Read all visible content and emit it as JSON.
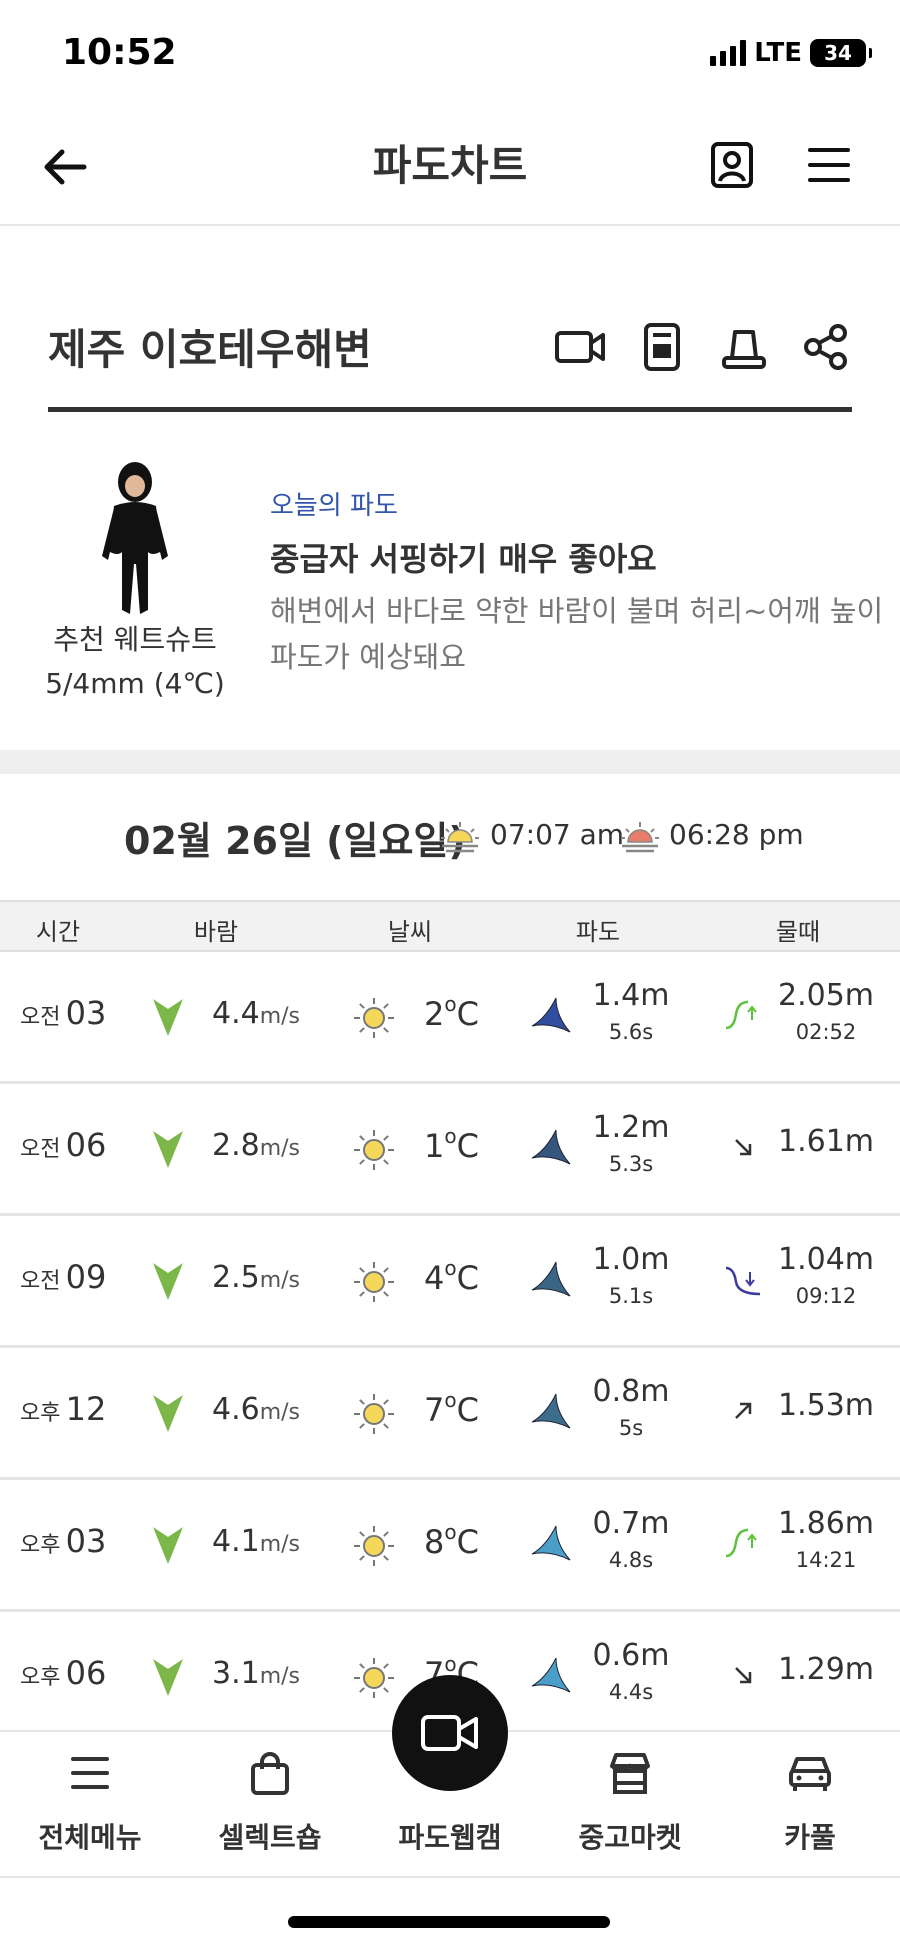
{
  "status": {
    "time": "10:52",
    "network": "LTE",
    "battery": "34"
  },
  "header": {
    "title": "파도차트",
    "back_icon": "back-arrow-icon",
    "profile_icon": "profile-icon",
    "menu_icon": "menu-icon"
  },
  "beach": {
    "name": "제주 이호테우해변",
    "icons": [
      "video-icon",
      "memo-icon",
      "alarm-icon",
      "share-icon"
    ]
  },
  "today": {
    "wetsuit_label": "추천 웨트슈트",
    "wetsuit_value": "5/4mm (4℃)",
    "label": "오늘의 파도",
    "headline": "중급자 서핑하기 매우 좋아요",
    "description": "해변에서 바다로 약한 바람이 불며 허리~어깨 높이 파도가 예상돼요"
  },
  "date": {
    "text": "02월 26일 (일요일)",
    "sunrise": "07:07 am",
    "sunset": "06:28 pm"
  },
  "columns": {
    "time": "시간",
    "wind": "바람",
    "weather": "날씨",
    "wave": "파도",
    "tide": "물때"
  },
  "rows": [
    {
      "ampm": "오전",
      "hour": "03",
      "wind": "4.4",
      "wind_unit": "m/s",
      "temp": "2",
      "wave_height": "1.4m",
      "wave_period": "5.6s",
      "wave_color": "#2f4f9e",
      "tide_icon": "high-tide",
      "tide_height": "2.05m",
      "tide_time": "02:52"
    },
    {
      "ampm": "오전",
      "hour": "06",
      "wind": "2.8",
      "wind_unit": "m/s",
      "temp": "1",
      "wave_height": "1.2m",
      "wave_period": "5.3s",
      "wave_color": "#35577f",
      "tide_icon": "falling",
      "tide_height": "1.61m",
      "tide_time": ""
    },
    {
      "ampm": "오전",
      "hour": "09",
      "wind": "2.5",
      "wind_unit": "m/s",
      "temp": "4",
      "wave_height": "1.0m",
      "wave_period": "5.1s",
      "wave_color": "#3a6685",
      "tide_icon": "low-tide",
      "tide_height": "1.04m",
      "tide_time": "09:12"
    },
    {
      "ampm": "오후",
      "hour": "12",
      "wind": "4.6",
      "wind_unit": "m/s",
      "temp": "7",
      "wave_height": "0.8m",
      "wave_period": "5s",
      "wave_color": "#3c6e8c",
      "tide_icon": "rising",
      "tide_height": "1.53m",
      "tide_time": ""
    },
    {
      "ampm": "오후",
      "hour": "03",
      "wind": "4.1",
      "wind_unit": "m/s",
      "temp": "8",
      "wave_height": "0.7m",
      "wave_period": "4.8s",
      "wave_color": "#4a9fca",
      "tide_icon": "high-tide",
      "tide_height": "1.86m",
      "tide_time": "14:21"
    },
    {
      "ampm": "오후",
      "hour": "06",
      "wind": "3.1",
      "wind_unit": "m/s",
      "temp": "7",
      "wave_height": "0.6m",
      "wave_period": "4.4s",
      "wave_color": "#4a9fca",
      "tide_icon": "falling",
      "tide_height": "1.29m",
      "tide_time": ""
    }
  ],
  "temp_unit": "C",
  "colors": {
    "wind_arrow": "#7ab648",
    "sun": "#f5d85a",
    "tide_high": "#5cc23c",
    "tide_low": "#3c3c9c"
  },
  "nav": [
    {
      "label": "전체메뉴",
      "icon": "menu-icon"
    },
    {
      "label": "셀렉트숍",
      "icon": "shopping-bag-icon"
    },
    {
      "label": "파도웹캠",
      "icon": "video-camera-icon"
    },
    {
      "label": "중고마켓",
      "icon": "store-icon"
    },
    {
      "label": "카풀",
      "icon": "car-icon"
    }
  ]
}
